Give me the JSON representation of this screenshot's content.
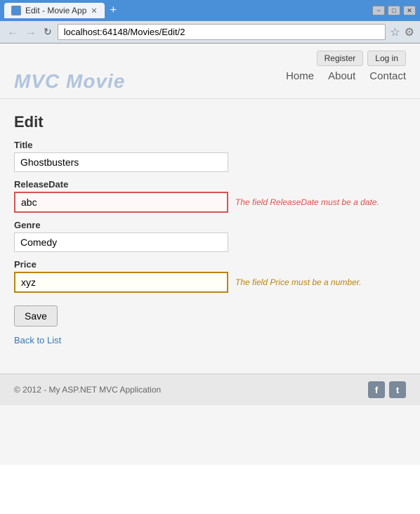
{
  "browser": {
    "tab_title": "Edit - Movie App",
    "new_tab_icon": "+",
    "back_btn": "←",
    "forward_btn": "→",
    "refresh_btn": "↻",
    "address": "localhost:64148/Movies/Edit/2",
    "star": "☆",
    "wrench": "⚙",
    "win_min": "−",
    "win_max": "□",
    "win_close": "✕"
  },
  "header": {
    "site_title": "MVC Movie",
    "register_label": "Register",
    "login_label": "Log in",
    "nav": [
      {
        "label": "Home",
        "href": "#"
      },
      {
        "label": "About",
        "href": "#"
      },
      {
        "label": "Contact",
        "href": "#"
      }
    ]
  },
  "form": {
    "heading": "Edit",
    "title_label": "Title",
    "title_value": "Ghostbusters",
    "release_label": "ReleaseDate",
    "release_value": "abc",
    "release_error": "The field ReleaseDate must be a date.",
    "genre_label": "Genre",
    "genre_value": "Comedy",
    "price_label": "Price",
    "price_value": "xyz",
    "price_error": "The field Price must be a number.",
    "save_label": "Save",
    "back_label": "Back to List"
  },
  "footer": {
    "text": "© 2012 - My ASP.NET MVC Application",
    "facebook": "f",
    "twitter": "t"
  }
}
